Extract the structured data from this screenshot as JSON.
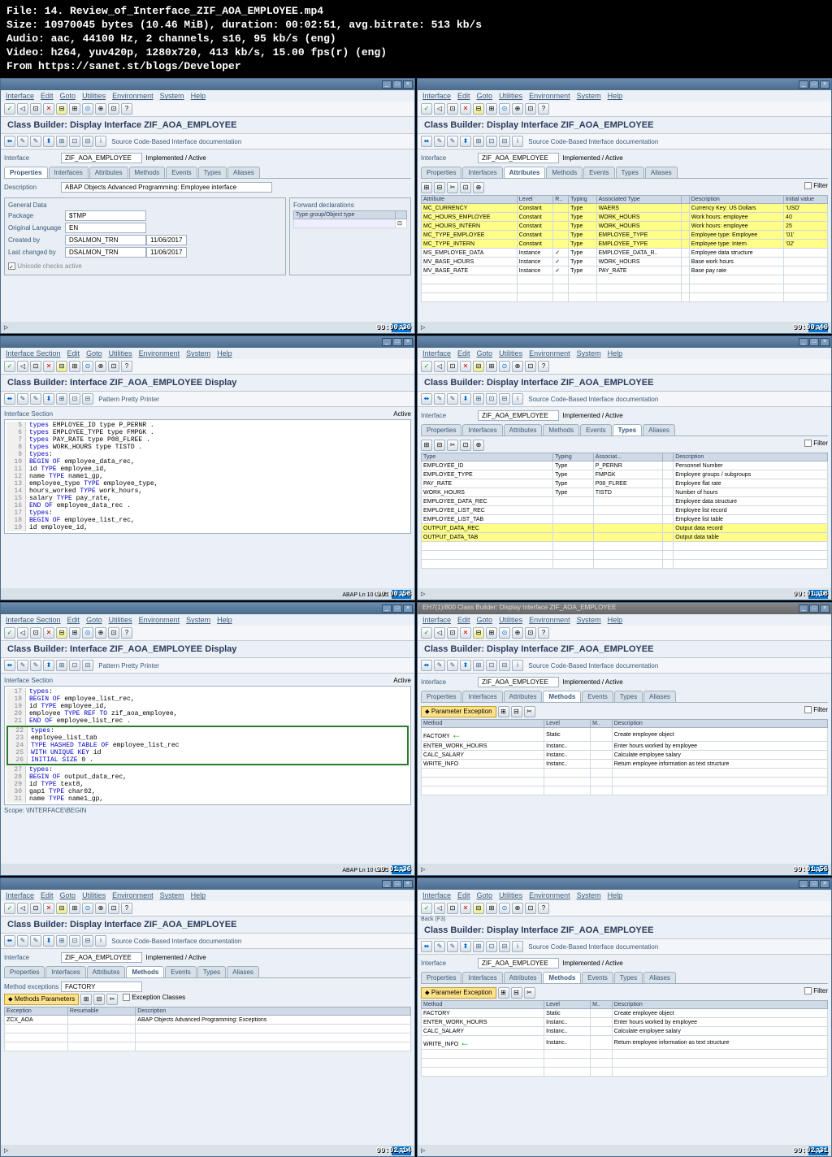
{
  "info": {
    "file": "File: 14. Review_of_Interface_ZIF_AOA_EMPLOYEE.mp4",
    "size": "Size: 10970045 bytes (10.46 MiB), duration: 00:02:51, avg.bitrate: 513 kb/s",
    "audio": "Audio: aac, 44100 Hz, 2 channels, s16, 95 kb/s (eng)",
    "video": "Video: h264, yuv420p, 1280x720, 413 kb/s, 15.00 fps(r) (eng)",
    "from": "From https://sanet.st/blogs/Developer"
  },
  "menu": {
    "items": [
      "Interface",
      "Edit",
      "Goto",
      "Utilities",
      "Environment",
      "System",
      "Help"
    ]
  },
  "menu2": {
    "items": [
      "Interface Section",
      "Edit",
      "Goto",
      "Utilities",
      "Environment",
      "System",
      "Help"
    ]
  },
  "header_display": "Class Builder: Display Interface ZIF_AOA_EMPLOYEE",
  "header_display2": "Class Builder: Interface ZIF_AOA_EMPLOYEE Display",
  "eh7_title": "EH7(1)/800 Class Builder: Display Interface ZIF_AOA_EMPLOYEE",
  "toolbar2_text": "Source Code-Based    Interface documentation",
  "pretty": "Pattern   Pretty Printer",
  "back_label": "Back  (F3)",
  "iface_label": "Interface",
  "iface_value": "ZIF_AOA_EMPLOYEE",
  "impl_active": "Implemented / Active",
  "active_label": "Active",
  "ifsec_label": "Interface Section",
  "filter_label": "Filter",
  "tabs": [
    "Properties",
    "Interfaces",
    "Attributes",
    "Methods",
    "Events",
    "Types",
    "Aliases"
  ],
  "p1": {
    "desc_label": "Description",
    "desc_value": "ABAP Objects Advanced Programming: Employee interface",
    "gen_title": "General Data",
    "pkg_l": "Package",
    "pkg_v": "$TMP",
    "lang_l": "Original Language",
    "lang_v": "EN",
    "cr_l": "Created by",
    "cr_v": "DSALMON_TRN",
    "cr_d": "11/06/2017",
    "ch_l": "Last changed by",
    "ch_v": "DSALMON_TRN",
    "ch_d": "11/06/2017",
    "uc": "Unicode checks active",
    "fwd_title": "Forward declarations",
    "fwd_col": "Type group/Object type"
  },
  "p2": {
    "cols": [
      "Attribute",
      "Level",
      "R..",
      "Typing",
      "Associated Type",
      "",
      "Description",
      "Initial value"
    ],
    "rows": [
      {
        "hl": true,
        "c": [
          "MC_CURRENCY",
          "Constant",
          "",
          "Type",
          "WAERS",
          "",
          "Currency Key: US Dollars",
          "'USD'"
        ]
      },
      {
        "hl": true,
        "c": [
          "MC_HOURS_EMPLOYEE",
          "Constant",
          "",
          "Type",
          "WORK_HOURS",
          "",
          "Work hours: employee",
          "40"
        ]
      },
      {
        "hl": true,
        "c": [
          "MC_HOURS_INTERN",
          "Constant",
          "",
          "Type",
          "WORK_HOURS",
          "",
          "Work hours: employee",
          "25"
        ]
      },
      {
        "hl": true,
        "c": [
          "MC_TYPE_EMPLOYEE",
          "Constant",
          "",
          "Type",
          "EMPLOYEE_TYPE",
          "",
          "Employee type: Employee",
          "'01'"
        ]
      },
      {
        "hl": true,
        "c": [
          "MC_TYPE_INTERN",
          "Constant",
          "",
          "Type",
          "EMPLOYEE_TYPE",
          "",
          "Employee type: Intern",
          "'02'"
        ]
      },
      {
        "hl": false,
        "c": [
          "MS_EMPLOYEE_DATA",
          "Instance",
          "✓",
          "Type",
          "EMPLOYEE_DATA_R..",
          "",
          "Employee data structure",
          ""
        ]
      },
      {
        "hl": false,
        "c": [
          "MV_BASE_HOURS",
          "Instance",
          "✓",
          "Type",
          "WORK_HOURS",
          "",
          "Base work hours",
          ""
        ]
      },
      {
        "hl": false,
        "c": [
          "MV_BASE_RATE",
          "Instance",
          "✓",
          "Type",
          "PAY_RATE",
          "",
          "Base pay rate",
          ""
        ]
      }
    ]
  },
  "p3_code": [
    {
      "n": 5,
      "t": "types EMPLOYEE_ID type P_PERNR ."
    },
    {
      "n": 6,
      "t": "types EMPLOYEE_TYPE type FMPGK ."
    },
    {
      "n": 7,
      "t": "types PAY_RATE type P08_FLREE ."
    },
    {
      "n": 8,
      "t": "types WORK_HOURS type TISTD ."
    },
    {
      "n": 9,
      "t": "types:"
    },
    {
      "n": 10,
      "t": "  BEGIN OF employee_data_rec,"
    },
    {
      "n": 11,
      "t": "    id TYPE employee_id,"
    },
    {
      "n": 12,
      "t": "    name TYPE name1_gp,"
    },
    {
      "n": 13,
      "t": "    employee_type TYPE employee_type,"
    },
    {
      "n": 14,
      "t": "    hours_worked TYPE work_hours,"
    },
    {
      "n": 15,
      "t": "    salary TYPE pay_rate,"
    },
    {
      "n": 16,
      "t": "  END OF employee_data_rec ."
    },
    {
      "n": 17,
      "t": "types:"
    },
    {
      "n": 18,
      "t": "  BEGIN OF employee_list_rec,"
    },
    {
      "n": 19,
      "t": "    id employee_id,"
    }
  ],
  "p3_footer": "ABAP   Ln  10 Col  5",
  "p4": {
    "cols": [
      "Type",
      "Typing",
      "Associat...",
      "",
      "Description"
    ],
    "rows": [
      {
        "hl": false,
        "c": [
          "EMPLOYEE_ID",
          "Type",
          "P_PERNR",
          "",
          "Personnel Number"
        ]
      },
      {
        "hl": false,
        "c": [
          "EMPLOYEE_TYPE",
          "Type",
          "FMPGK",
          "",
          "Employee groups / subgroups"
        ]
      },
      {
        "hl": false,
        "c": [
          "PAY_RATE",
          "Type",
          "P08_FLREE",
          "",
          "Employee flat rate"
        ]
      },
      {
        "hl": false,
        "c": [
          "WORK_HOURS",
          "Type",
          "TISTD",
          "",
          "Number of hours"
        ]
      },
      {
        "hl": false,
        "c": [
          "EMPLOYEE_DATA_REC",
          "",
          "",
          "",
          "Employee data structure"
        ]
      },
      {
        "hl": false,
        "c": [
          "EMPLOYEE_LIST_REC",
          "",
          "",
          "",
          "Employee list record"
        ]
      },
      {
        "hl": false,
        "c": [
          "EMPLOYEE_LIST_TAB",
          "",
          "",
          "",
          "Employee list table"
        ]
      },
      {
        "hl": true,
        "c": [
          "OUTPUT_DATA_REC",
          "",
          "",
          "",
          "Output data record"
        ]
      },
      {
        "hl": true,
        "c": [
          "OUTPUT_DATA_TAB",
          "",
          "",
          "",
          "Output data table"
        ]
      }
    ]
  },
  "p5_code": [
    {
      "n": 17,
      "t": "types:"
    },
    {
      "n": 18,
      "t": "  BEGIN OF employee_list_rec,"
    },
    {
      "n": 19,
      "t": "    id TYPE employee_id,"
    },
    {
      "n": 20,
      "t": "    employee TYPE REF TO zif_aoa_employee,"
    },
    {
      "n": 21,
      "t": "  END OF employee_list_rec ."
    }
  ],
  "p5_code_hl": [
    {
      "n": 22,
      "t": "types:"
    },
    {
      "n": 23,
      "t": "  employee_list_tab"
    },
    {
      "n": 24,
      "t": "  TYPE HASHED TABLE OF employee_list_rec"
    },
    {
      "n": 25,
      "t": "  WITH UNIQUE KEY id"
    },
    {
      "n": 26,
      "t": "  INITIAL SIZE 0 ."
    }
  ],
  "p5_code2": [
    {
      "n": 27,
      "t": "types:"
    },
    {
      "n": 28,
      "t": "  BEGIN OF output_data_rec,"
    },
    {
      "n": 29,
      "t": "    id TYPE text8,"
    },
    {
      "n": 30,
      "t": "    gap1 TYPE char02,"
    },
    {
      "n": 31,
      "t": "    name TYPE name1_gp,"
    }
  ],
  "p5_scope": "Scope: \\INTERFACE\\BEGIN",
  "p5_footer": "ABAP   Ln  10 Col  5",
  "p6": {
    "btns": "Parameter    Exception",
    "cols": [
      "Method",
      "Level",
      "M..",
      "Description"
    ],
    "rows": [
      {
        "c": [
          "FACTORY",
          "Static",
          "",
          "Create employee object"
        ],
        "arrow": true
      },
      {
        "c": [
          "ENTER_WORK_HOURS",
          "Instanc..",
          "",
          "Enter hours worked by employee"
        ]
      },
      {
        "c": [
          "CALC_SALARY",
          "Instanc..",
          "",
          "Calculate employee salary"
        ]
      },
      {
        "c": [
          "WRITE_INFO",
          "Instanc..",
          "",
          "Return employee information as text structure"
        ]
      }
    ]
  },
  "p7": {
    "mex": "Method exceptions",
    "fac": "FACTORY",
    "btns": "Methods    Parameters",
    "excl": "Exception Classes",
    "cols": [
      "Exception",
      "Resumable",
      "Description"
    ],
    "rows": [
      {
        "c": [
          "ZCX_AOA",
          "",
          "ABAP Objects Advanced Programming: Exceptions"
        ]
      }
    ]
  },
  "p8": {
    "btns": "Parameter    Exception",
    "cols": [
      "Method",
      "Level",
      "M..",
      "Description"
    ],
    "rows": [
      {
        "c": [
          "FACTORY",
          "Static",
          "",
          "Create employee object"
        ]
      },
      {
        "c": [
          "ENTER_WORK_HOURS",
          "Instanc..",
          "",
          "Enter hours worked by employee"
        ]
      },
      {
        "c": [
          "CALC_SALARY",
          "Instanc..",
          "",
          "Calculate employee salary"
        ]
      },
      {
        "c": [
          "WRITE_INFO",
          "Instanc..",
          "",
          "Return employee information as text structure"
        ],
        "arrow": true
      }
    ]
  },
  "timestamps": [
    "00:00:30",
    "00:00:40",
    "00:00:58",
    "00:01:18",
    "00:01:36",
    "00:01:56",
    "00:02:14",
    "00:02:31"
  ]
}
